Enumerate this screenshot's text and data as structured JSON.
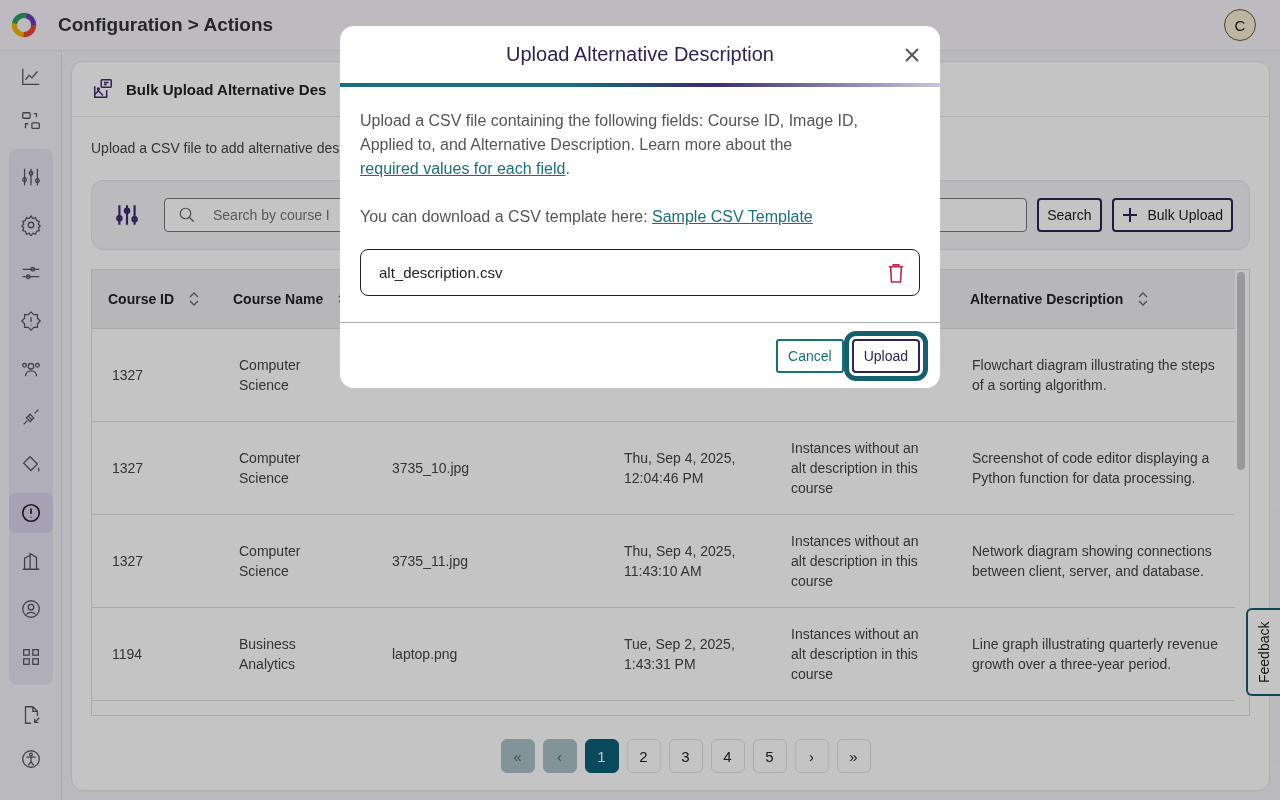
{
  "header": {
    "breadcrumb": "Configuration > Actions",
    "avatar": "C"
  },
  "sidebar": {
    "top_items": [
      {
        "selected": false
      },
      {
        "selected": false
      }
    ],
    "group_items": [
      {
        "selected": false
      },
      {
        "selected": false
      },
      {
        "selected": false
      },
      {
        "selected": false
      },
      {
        "selected": false
      },
      {
        "selected": false
      },
      {
        "selected": false
      },
      {
        "selected": true
      },
      {
        "selected": false
      },
      {
        "selected": false
      },
      {
        "selected": false
      }
    ],
    "bottom_items": [
      {
        "selected": false
      },
      {
        "selected": false
      }
    ]
  },
  "page": {
    "title": "Bulk Upload Alternative Des",
    "description": "Upload a CSV file to add alternative des"
  },
  "filters": {
    "search": {
      "placeholder": "Search by course I"
    },
    "search_button": "Search",
    "bulk_upload_button": "Bulk Upload"
  },
  "table": {
    "columns": [
      {
        "label": "Course ID",
        "sortable": true
      },
      {
        "label": "Course Name",
        "sortable": true
      },
      {},
      {},
      {},
      {
        "label": "Alternative Description",
        "sortable": true
      }
    ],
    "rows": [
      {
        "course_id": "1327",
        "course_name": "Computer Science",
        "alt_description": "Flowchart diagram illustrating the steps of a sorting algorithm."
      },
      {
        "course_id": "1327",
        "course_name": "Computer Science",
        "image_id": "3735_10.jpg",
        "uploaded": "Thu, Sep 4, 2025, 12:04:46 PM",
        "applied_to": "Instances without an alt description in this course",
        "alt_description": "Screenshot of code editor displaying a Python function for data processing."
      },
      {
        "course_id": "1327",
        "course_name": "Computer Science",
        "image_id": "3735_11.jpg",
        "uploaded": "Thu, Sep 4, 2025, 11:43:10 AM",
        "applied_to": "Instances without an alt description in this course",
        "alt_description": "Network diagram showing connections between client, server, and database."
      },
      {
        "course_id": "1194",
        "course_name": "Business Analytics",
        "image_id": "laptop.png",
        "uploaded": "Tue, Sep 2, 2025, 1:43:31 PM",
        "applied_to": "Instances without an alt description in this course",
        "alt_description": "Line graph illustrating quarterly revenue growth over a three-year period."
      }
    ]
  },
  "pagination": {
    "first": {
      "label": "«",
      "disabled": true
    },
    "prev": {
      "label": "‹",
      "disabled": true
    },
    "pages": [
      {
        "label": "1",
        "selected": true
      },
      {
        "label": "2",
        "selected": false
      },
      {
        "label": "3",
        "selected": false
      },
      {
        "label": "4",
        "selected": false
      },
      {
        "label": "5",
        "selected": false
      }
    ],
    "next": {
      "label": "›",
      "disabled": false
    },
    "last": {
      "label": "»",
      "disabled": false
    }
  },
  "feedback_tab": "Feedback",
  "modal": {
    "title": "Upload Alternative Description",
    "intro": {
      "text": "Upload a CSV file containing the following fields: Course ID, Image ID, Applied to, and Alternative Description. Learn more about the",
      "link": "required values for each field",
      "after": "."
    },
    "template": {
      "text": "You can download a CSV template here:",
      "link": "Sample CSV Template"
    },
    "file": {
      "name": "alt_description.csv"
    },
    "cancel_button": {
      "label": "Cancel",
      "focused": false
    },
    "upload_button": {
      "label": "Upload",
      "focused": true
    }
  }
}
